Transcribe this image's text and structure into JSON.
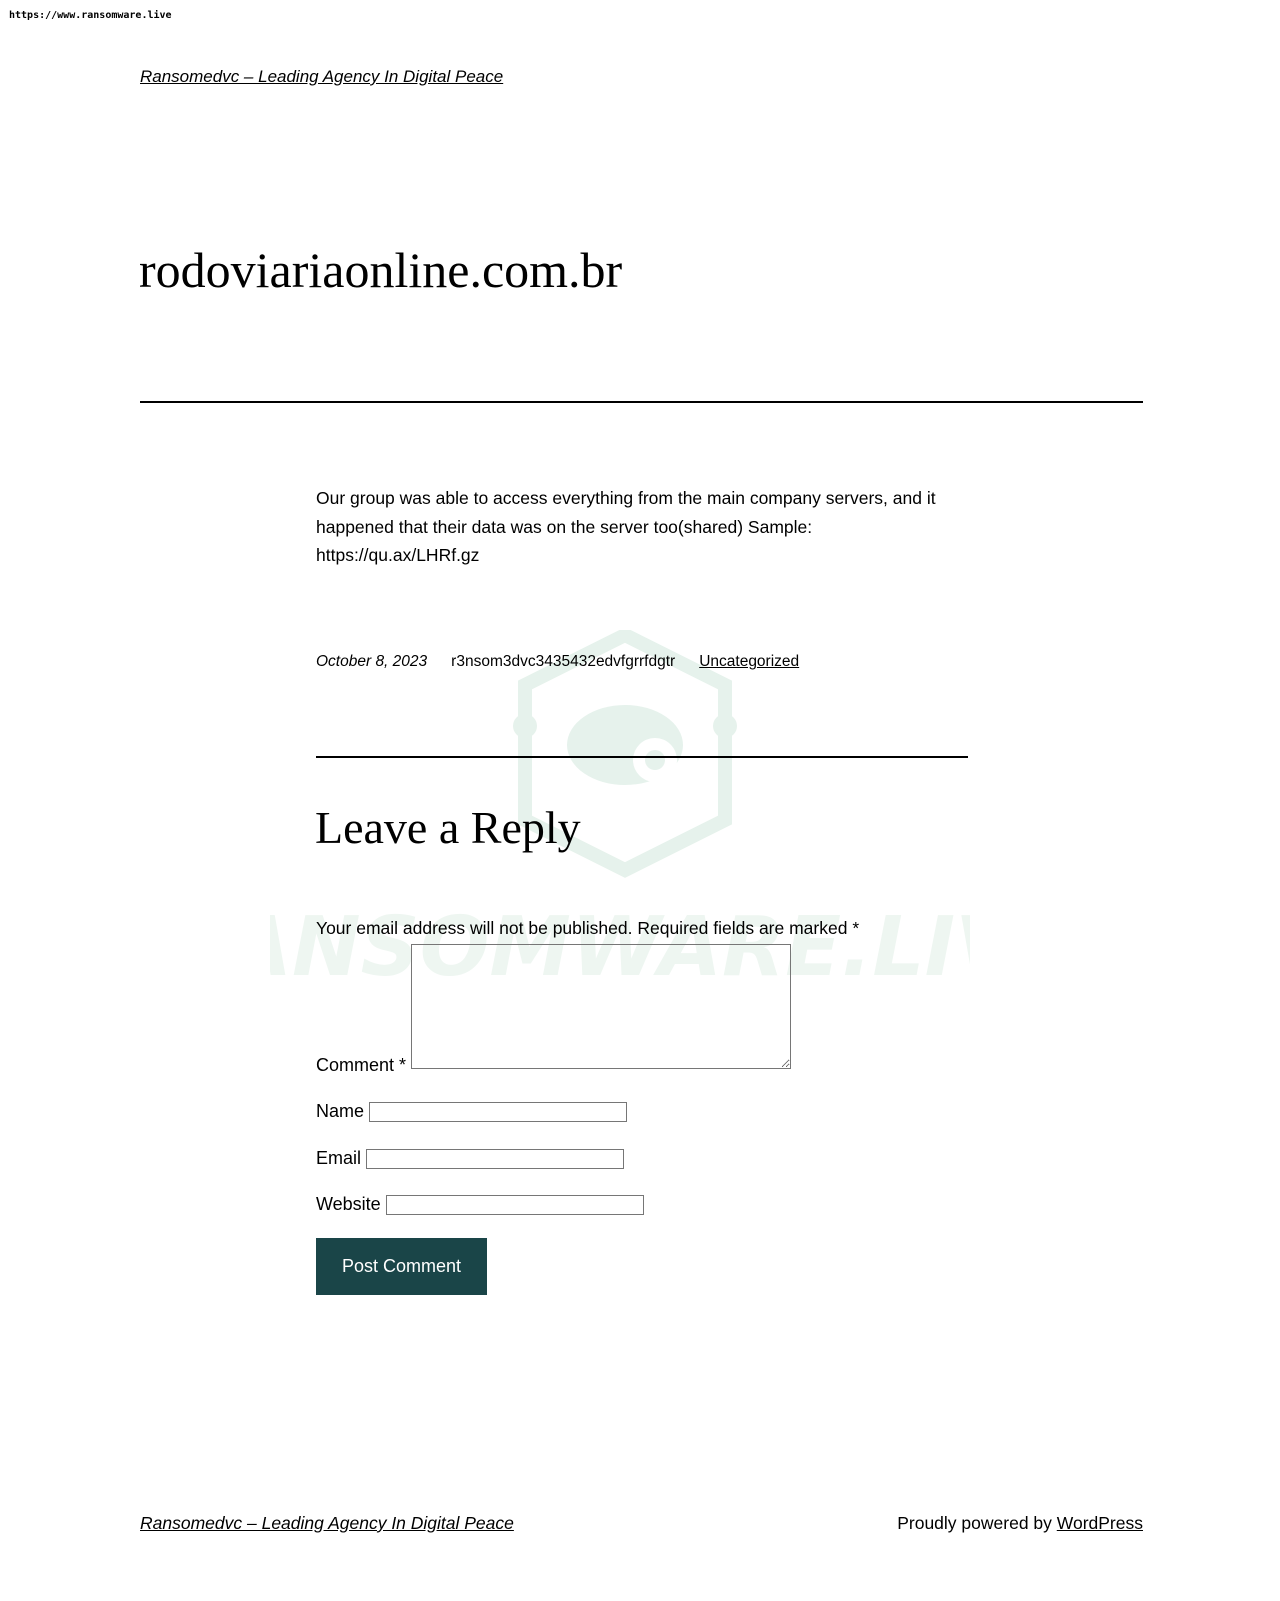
{
  "watermark_url": "https://www.ransomware.live",
  "header": {
    "site_title": "Ransomedvc – Leading Agency In Digital Peace"
  },
  "post": {
    "title": "rodoviariaonline.com.br",
    "body": "Our group was able to access everything from the main company servers, and it happened that their data was on the server too(shared) Sample: https://qu.ax/LHRf.gz",
    "date": "October 8, 2023",
    "author": "r3nsom3dvc3435432edvfgrrfdgtr",
    "category": "Uncategorized"
  },
  "comments": {
    "reply_title": "Leave a Reply",
    "notes": "Your email address will not be published. Required fields are marked *",
    "comment_label": "Comment *",
    "name_label": "Name",
    "email_label": "Email",
    "website_label": "Website",
    "submit_label": "Post Comment"
  },
  "footer": {
    "site_title": "Ransomedvc – Leading Agency In Digital Peace",
    "powered_prefix": "Proudly powered by",
    "powered_link": "WordPress"
  },
  "colors": {
    "button": "#1a4548",
    "watermark": "#e6f2ec"
  }
}
